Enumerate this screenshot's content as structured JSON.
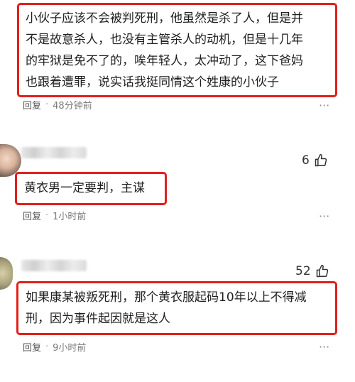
{
  "comments": [
    {
      "lines": [
        "小伙子应该不会被判死刑，他虽然是杀了人，但是并",
        "不是故意杀人，也没有主管杀人的动机，但是十几年",
        "的牢狱是免不了的，唉年轻人，太冲动了，这下爸妈",
        "也跟着遭罪，说实话我挺同情这个姓康的小伙子"
      ],
      "reply_label": "回复",
      "time": "48分钟前"
    },
    {
      "likes": "6",
      "lines": [
        "黄衣男一定要判，主谋"
      ],
      "reply_label": "回复",
      "time": "1小时前"
    },
    {
      "likes": "52",
      "lines": [
        "如果康某被叛死刑，那个黄衣服起码10年以上不得减",
        "刑，因为事件起因就是这人"
      ],
      "reply_label": "回复",
      "time": "9小时前"
    }
  ],
  "icons": {
    "more": "more-dots-icon",
    "like": "thumbs-up-icon"
  },
  "colors": {
    "highlight_border": "#e0201b",
    "meta_text": "#7a7a7a"
  },
  "more_glyph": "···"
}
